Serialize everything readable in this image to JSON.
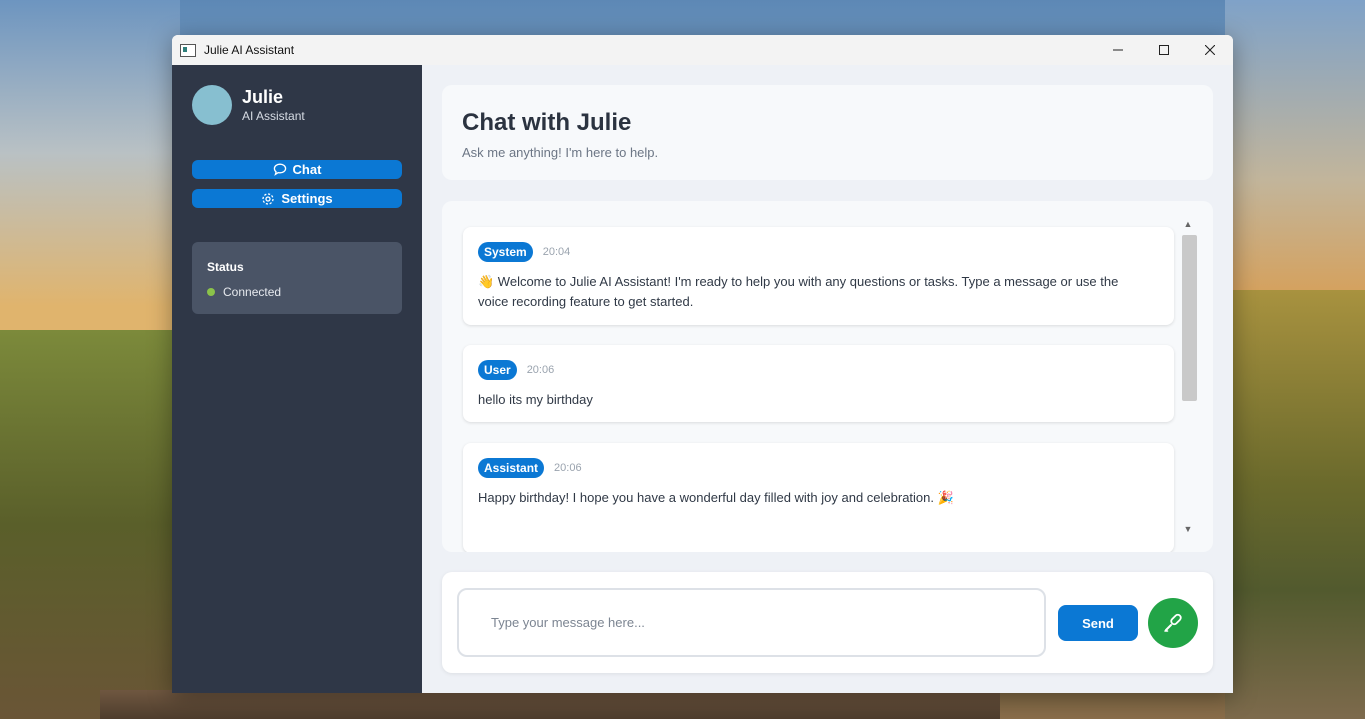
{
  "window": {
    "title": "Julie AI Assistant"
  },
  "sidebar": {
    "name": "Julie",
    "role": "AI Assistant",
    "nav": [
      {
        "label": "Chat",
        "icon": "chat-bubble-icon"
      },
      {
        "label": "Settings",
        "icon": "gear-icon"
      }
    ],
    "status": {
      "heading": "Status",
      "value": "Connected",
      "color": "#8bc34a"
    }
  },
  "header": {
    "title": "Chat with Julie",
    "subtitle": "Ask me anything! I'm here to help."
  },
  "messages": [
    {
      "sender": "System",
      "time": "20:04",
      "text": "👋 Welcome to Julie AI Assistant! I'm ready to help you with any questions or tasks. Type a message or use the voice recording feature to get started."
    },
    {
      "sender": "User",
      "time": "20:06",
      "text": "hello its my birthday"
    },
    {
      "sender": "Assistant",
      "time": "20:06",
      "text": "Happy birthday! I hope you have a wonderful day filled with joy and celebration.  🎉"
    }
  ],
  "composer": {
    "placeholder": "Type your message here...",
    "send_label": "Send",
    "mic_icon": "microphone-icon"
  },
  "colors": {
    "accent": "#0b78d4",
    "sidebar": "#2f3747",
    "mic": "#22a447"
  }
}
